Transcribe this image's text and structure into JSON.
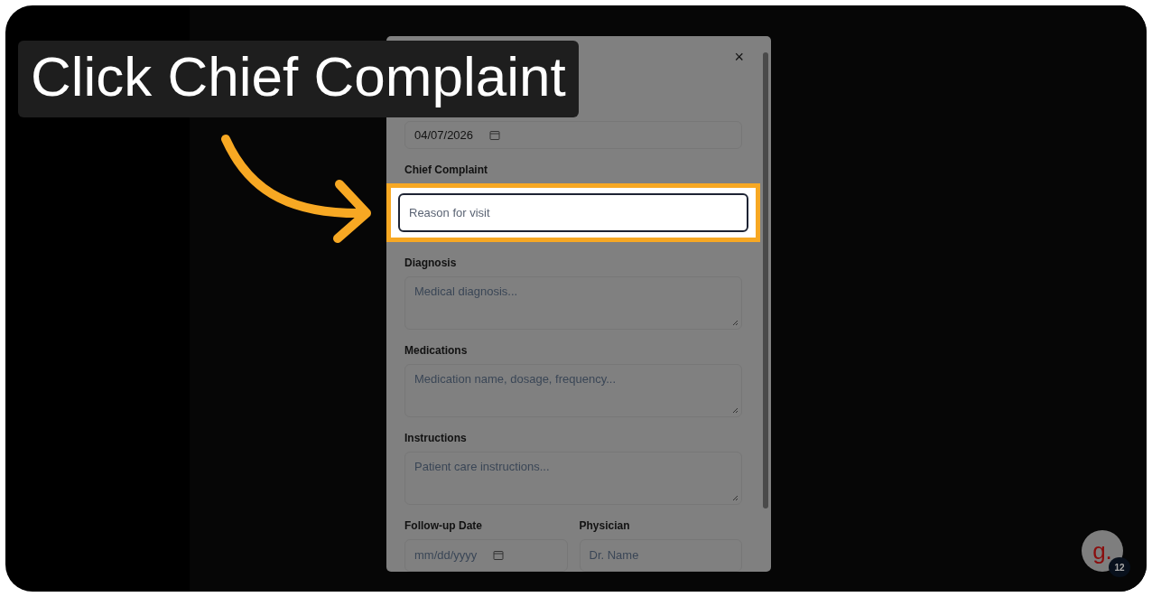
{
  "caption": {
    "text": "Click Chief Complaint"
  },
  "modal": {
    "close": "×",
    "fields": [
      {
        "kind": "date",
        "value": "04/07/2026"
      },
      {
        "kind": "input",
        "label": "Chief Complaint",
        "placeholder": "Reason for visit",
        "focused": true
      },
      {
        "kind": "textarea",
        "label": "Diagnosis",
        "placeholder": "Medical diagnosis..."
      },
      {
        "kind": "textarea",
        "label": "Medications",
        "placeholder": "Medication name, dosage, frequency..."
      },
      {
        "kind": "textarea",
        "label": "Instructions",
        "placeholder": "Patient care instructions..."
      }
    ],
    "row": [
      {
        "kind": "date",
        "label": "Follow-up Date",
        "placeholder": "mm/dd/yyyy"
      },
      {
        "kind": "input",
        "label": "Physician",
        "placeholder": "Dr. Name"
      }
    ]
  },
  "widget": {
    "logo": "g.",
    "count": "12"
  }
}
